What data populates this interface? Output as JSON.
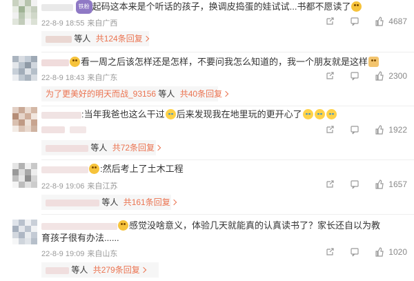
{
  "colors": {
    "accent": "#eb7350",
    "meta": "#999999"
  },
  "comments": [
    {
      "text": "起码这本来是个听话的孩子，换调皮捣蛋的娃试试...书都不愿读了",
      "badge": "铁粉",
      "date": "22-8-9 18:55",
      "location": "来自广西",
      "likes": "4687",
      "reply_user": "",
      "reply_etc": "等人",
      "reply_count": "共124条回复"
    },
    {
      "text": "看一周之后该怎样还是怎样，不要问我怎么知道的，我一个朋友就是这样",
      "badge": "",
      "date": "22-8-9 18:43",
      "location": "来自广东",
      "likes": "2300",
      "reply_user": "为了更美好的明天而战_93156",
      "reply_etc": "等人",
      "reply_count": "共40条回复"
    },
    {
      "text": ":当年我爸也这么干过",
      "text2": "后来发现我在地里玩的更开心了",
      "badge": "",
      "date": "",
      "location": "",
      "likes": "1922",
      "reply_user": "",
      "reply_etc": "等人",
      "reply_count": "共72条回复"
    },
    {
      "text": ":然后考上了土木工程",
      "badge": "",
      "date": "22-8-9 19:06",
      "location": "来自江苏",
      "likes": "1657",
      "reply_user": "",
      "reply_etc": "等人",
      "reply_count": "共161条回复"
    },
    {
      "text": "感觉没啥意义，体验几天就能真的认真读书了？家长还自以为教育孩子很有办法......",
      "badge": "",
      "date": "22-8-9 19:09",
      "location": "来自山东",
      "likes": "1020",
      "reply_user": "",
      "reply_etc": "等人",
      "reply_count": "共279条回复"
    }
  ]
}
